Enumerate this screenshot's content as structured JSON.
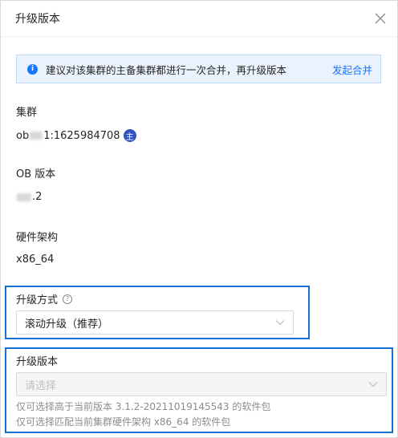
{
  "dialog": {
    "title": "升级版本"
  },
  "alert": {
    "message": "建议对该集群的主备集群都进行一次合并，再升级版本",
    "action": "发起合并"
  },
  "cluster": {
    "label": "集群",
    "value_prefix": "ob",
    "value_suffix": "1:1625984708",
    "badge": "主"
  },
  "ob_version": {
    "label": "OB 版本",
    "value_suffix": ".2"
  },
  "hardware": {
    "label": "硬件架构",
    "value": "x86_64"
  },
  "upgrade_method": {
    "label": "升级方式",
    "selected": "滚动升级（推荐）"
  },
  "upgrade_version": {
    "label": "升级版本",
    "placeholder": "请选择",
    "help1": "仅可选择高于当前版本 3.1.2-20211019145543 的软件包",
    "help2": "仅可选择匹配当前集群硬件架构 x86_64 的软件包"
  },
  "colors": {
    "primary": "#1677ff",
    "highlight_border": "#1570d5",
    "badge": "#2f54c2"
  }
}
